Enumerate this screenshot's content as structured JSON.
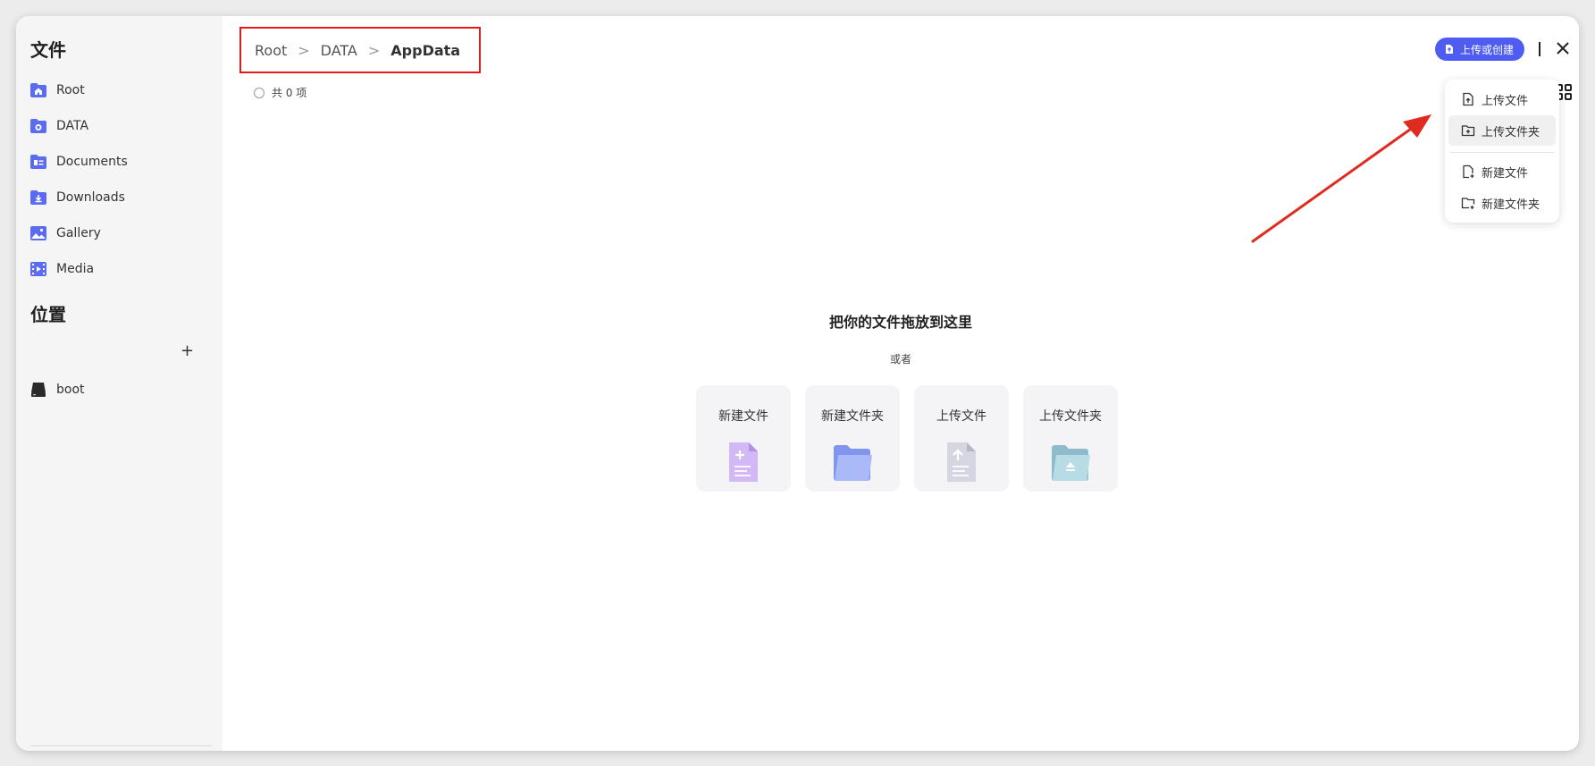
{
  "sidebar": {
    "files_heading": "文件",
    "items": [
      {
        "label": "Root",
        "icon": "home-folder-icon"
      },
      {
        "label": "DATA",
        "icon": "data-folder-icon"
      },
      {
        "label": "Documents",
        "icon": "documents-folder-icon"
      },
      {
        "label": "Downloads",
        "icon": "downloads-folder-icon"
      },
      {
        "label": "Gallery",
        "icon": "gallery-icon"
      },
      {
        "label": "Media",
        "icon": "media-icon"
      }
    ],
    "locations_heading": "位置",
    "add_location_label": "+",
    "locations": [
      {
        "label": "boot",
        "icon": "drive-icon"
      }
    ]
  },
  "breadcrumb": {
    "items": [
      "Root",
      "DATA",
      "AppData"
    ],
    "separator": ">"
  },
  "list": {
    "count_label": "共 0 项"
  },
  "empty_state": {
    "title": "把你的文件拖放到这里",
    "or_label": "或者",
    "cards": [
      {
        "label": "新建文件",
        "icon": "new-file-icon"
      },
      {
        "label": "新建文件夹",
        "icon": "new-folder-icon"
      },
      {
        "label": "上传文件",
        "icon": "upload-file-icon"
      },
      {
        "label": "上传文件夹",
        "icon": "upload-folder-icon"
      }
    ]
  },
  "toolbar": {
    "upload_create_label": "上传或创建",
    "close_icon": "close-icon",
    "grid_icon": "grid-view-icon"
  },
  "menu": {
    "items": [
      {
        "label": "上传文件",
        "icon": "upload-file-icon"
      },
      {
        "label": "上传文件夹",
        "icon": "upload-folder-icon",
        "highlighted": true
      },
      {
        "label": "新建文件",
        "icon": "new-file-icon"
      },
      {
        "label": "新建文件夹",
        "icon": "new-folder-icon"
      }
    ]
  },
  "colors": {
    "accent": "#4f5cf2",
    "sidebar_icon": "#5b6cf0",
    "highlight_border": "#e31b1b",
    "annotation_arrow": "#e02b20"
  }
}
